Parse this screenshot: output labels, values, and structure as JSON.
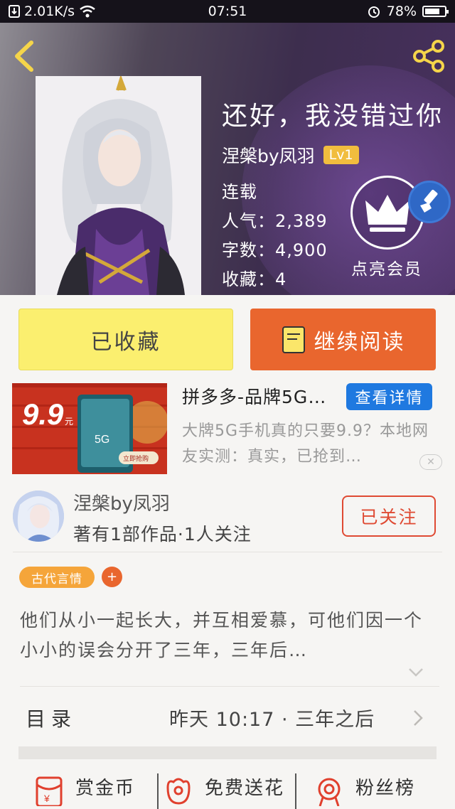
{
  "status_bar": {
    "net_speed": "2.01K/s",
    "time": "07:51",
    "battery": "78%",
    "battery_level": 0.78
  },
  "book": {
    "title": "还好，我没错过你",
    "author": "涅槃by凤羽",
    "author_level": "Lv1",
    "status": "连载",
    "popularity": "人气：2,389",
    "word_count": "字数：4,900",
    "favorites": "收藏：4"
  },
  "vip": {
    "label": "点亮会员"
  },
  "actions": {
    "collect_label": "已收藏",
    "read_label": "继续阅读"
  },
  "ad": {
    "title": "拼多多-品牌5G手机",
    "detail_label": "查看详情",
    "description": "大牌5G手机真的只要9.9？本地网友实测：真实，已抢到…",
    "image_price": "9.9",
    "image_price_unit": "元",
    "image_5g": "5G",
    "image_button": "立即抢购",
    "close_label": "✕"
  },
  "author_card": {
    "name": "涅槃by凤羽",
    "stats": "著有1部作品·1人关注",
    "follow_label": "已关注"
  },
  "tags": {
    "items": [
      "古代言情"
    ],
    "add_label": "+"
  },
  "synopsis": {
    "text": "他们从小一起长大，并互相爱慕，可他们因一个小小的误会分开了三年，三年后…"
  },
  "toc": {
    "label": "目录",
    "latest_update": "昨天 10:17 · 三年之后"
  },
  "bottom_actions": {
    "reward_label": "赏金币",
    "flower_label": "免费送花",
    "fans_label": "粉丝榜"
  },
  "colors": {
    "accent_orange": "#e9662e",
    "collect_yellow": "#fbef6f",
    "tag_orange": "#f5a53a",
    "follow_red": "#df4a33",
    "ad_blue": "#1f79e0",
    "level_gold": "#f1bd3e"
  },
  "icons": {
    "back": "back-chevron-icon",
    "share": "share-icon",
    "vip": "crown-icon",
    "brush": "brush-icon",
    "read": "book-icon",
    "reward": "red-envelope-icon",
    "flower": "flower-icon",
    "fans": "medal-icon"
  }
}
